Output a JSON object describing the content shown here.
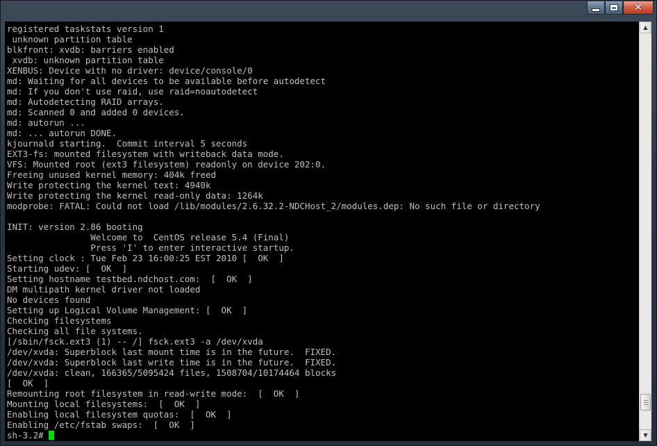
{
  "window": {
    "controls": {
      "minimize_icon": "minimize-icon",
      "maximize_icon": "maximize-icon",
      "close_icon": "close-icon",
      "close_glyph": "✕"
    }
  },
  "console": {
    "lines": [
      "registered taskstats version 1",
      " unknown partition table",
      "blkfront: xvdb: barriers enabled",
      " xvdb: unknown partition table",
      "XENBUS: Device with no driver: device/console/0",
      "md: Waiting for all devices to be available before autodetect",
      "md: If you don't use raid, use raid=noautodetect",
      "md: Autodetecting RAID arrays.",
      "md: Scanned 0 and added 0 devices.",
      "md: autorun ...",
      "md: ... autorun DONE.",
      "kjournald starting.  Commit interval 5 seconds",
      "EXT3-fs: mounted filesystem with writeback data mode.",
      "VFS: Mounted root (ext3 filesystem) readonly on device 202:0.",
      "Freeing unused kernel memory: 404k freed",
      "Write protecting the kernel text: 4940k",
      "Write protecting the kernel read-only data: 1264k",
      "modprobe: FATAL: Could not load /lib/modules/2.6.32.2-NDCHost_2/modules.dep: No such file or directory",
      "",
      "INIT: version 2.86 booting",
      "                Welcome to  CentOS release 5.4 (Final)",
      "                Press 'I' to enter interactive startup.",
      "Setting clock : Tue Feb 23 16:00:25 EST 2010 [  OK  ]",
      "Starting udev: [  OK  ]",
      "Setting hostname testbed.ndchost.com:  [  OK  ]",
      "DM multipath kernel driver not loaded",
      "No devices found",
      "Setting up Logical Volume Management: [  OK  ]",
      "Checking filesystems",
      "Checking all file systems.",
      "[/sbin/fsck.ext3 (1) -- /] fsck.ext3 -a /dev/xvda",
      "/dev/xvda: Superblock last mount time is in the future.  FIXED.",
      "/dev/xvda: Superblock last write time is in the future.  FIXED.",
      "/dev/xvda: clean, 166365/5095424 files, 1508704/10174464 blocks",
      "[  OK  ]",
      "Remounting root filesystem in read-write mode:  [  OK  ]",
      "Mounting local filesystems:  [  OK  ]",
      "Enabling local filesystem quotas:  [  OK  ]",
      "Enabling /etc/fstab swaps:  [  OK  ]"
    ],
    "prompt": "sh-3.2# "
  },
  "scrollbar": {
    "up_glyph": "▲",
    "down_glyph": "▼",
    "position": 0.95
  }
}
